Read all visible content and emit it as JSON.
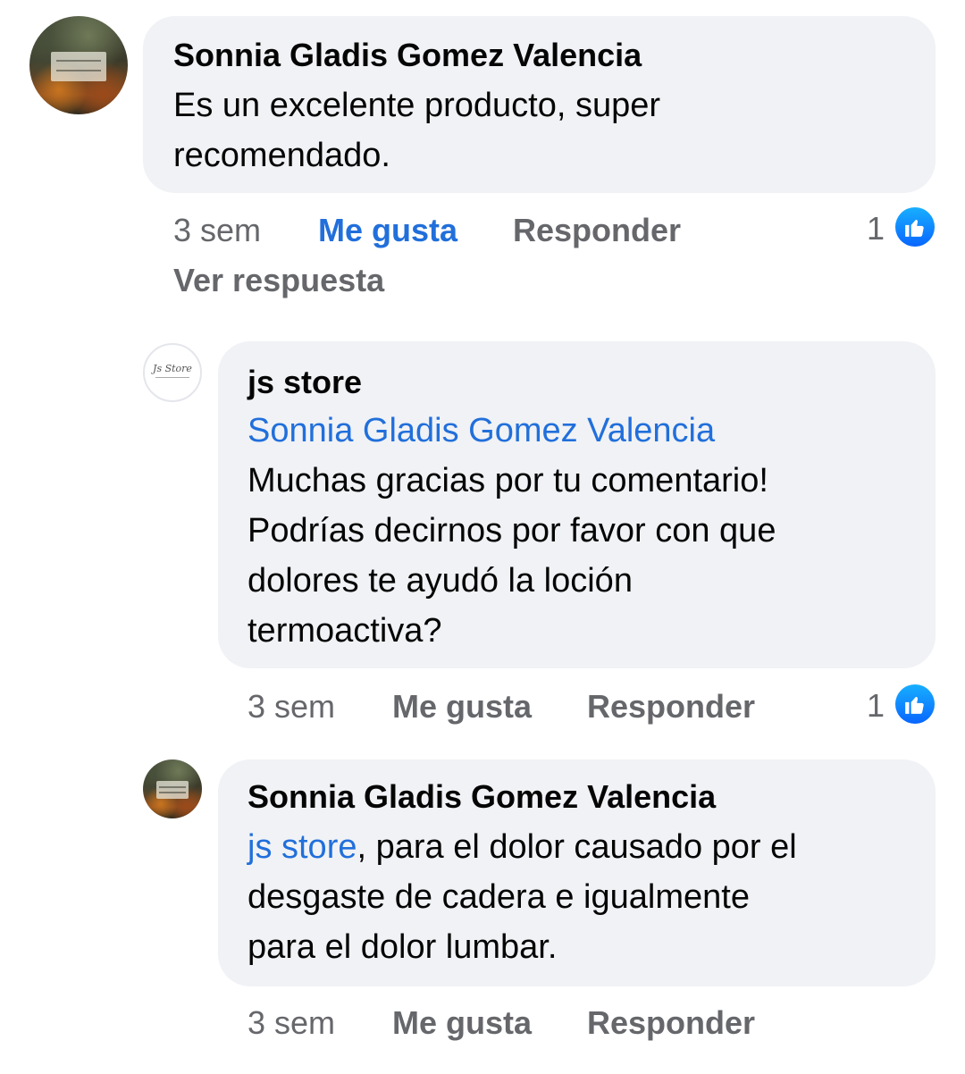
{
  "comments": [
    {
      "author": "Sonnia Gladis Gomez Valencia",
      "text_line1": "Es un excelente producto, super",
      "text_line2": "recomendado.",
      "time": "3 sem",
      "like_label": "Me gusta",
      "reply_label": "Responder",
      "reaction_count": "1",
      "reaction_type": "like-icon",
      "liked_by_viewer": true,
      "see_replies_label": "Ver respuesta"
    },
    {
      "author": "js store",
      "avatar_logo_text": "Js Store",
      "mention": "Sonnia Gladis Gomez Valencia",
      "text_line1": "Muchas gracias por tu comentario!",
      "text_line2": "Podrías decirnos por favor con que",
      "text_line3": "dolores te ayudó la loción",
      "text_line4": "termoactiva?",
      "time": "3 sem",
      "like_label": "Me gusta",
      "reply_label": "Responder",
      "reaction_count": "1",
      "reaction_type": "like-icon",
      "liked_by_viewer": false
    },
    {
      "author": "Sonnia Gladis Gomez Valencia",
      "mention": "js store",
      "text_line1_rest": ", para el dolor causado por el",
      "text_line2": "desgaste de cadera e igualmente",
      "text_line3": "para el dolor lumbar.",
      "time": "3 sem",
      "like_label": "Me gusta",
      "reply_label": "Responder",
      "liked_by_viewer": false
    }
  ],
  "colors": {
    "bubble": "#f0f2f5",
    "link": "#216fdb",
    "secondary_text": "#65676b",
    "like_blue": "#0866ff"
  }
}
